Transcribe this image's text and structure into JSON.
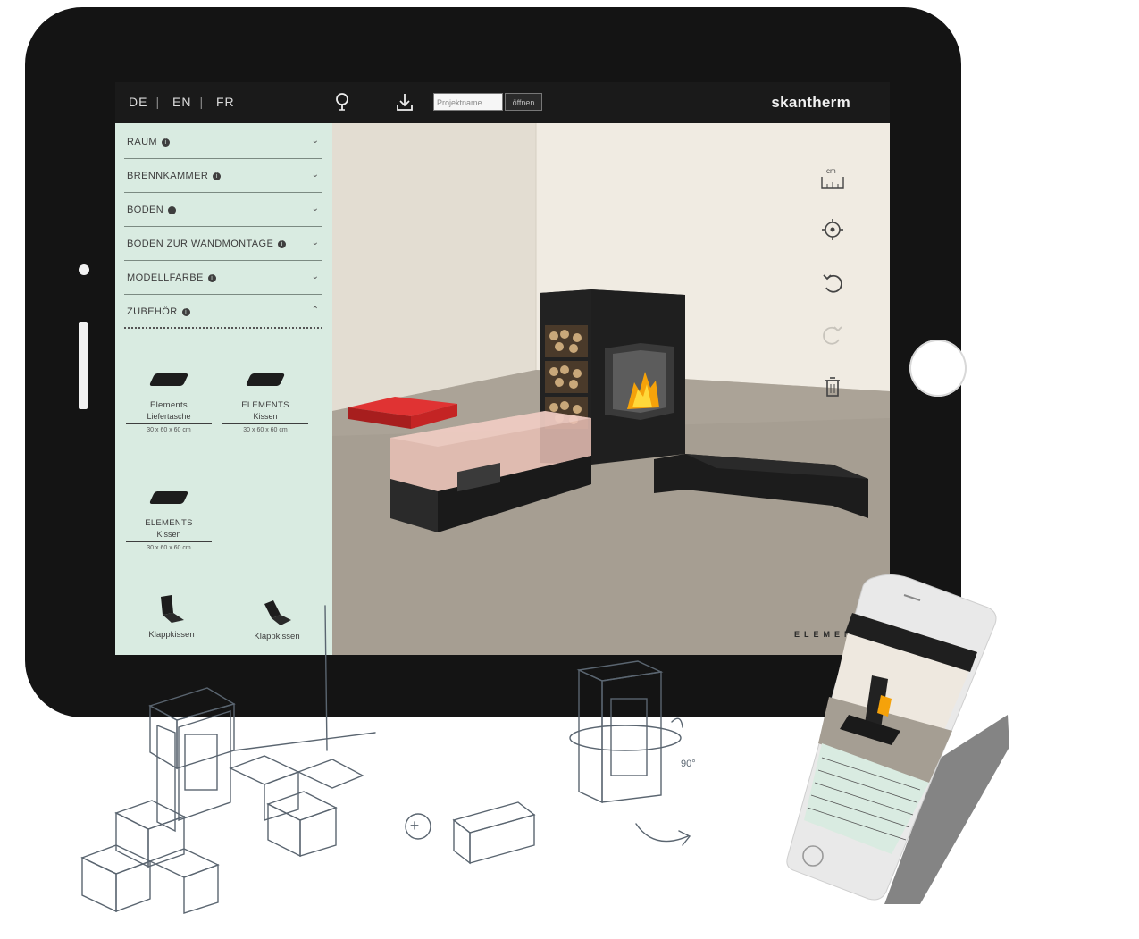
{
  "tablet": {
    "topbar": {
      "languages": [
        "DE",
        "EN",
        "FR"
      ],
      "separator": "|",
      "project_placeholder": "Projektname",
      "project_button": "öffnen",
      "logo": "skantherm"
    },
    "sidebar": {
      "sections": [
        {
          "label": "RAUM",
          "state": "collapsed"
        },
        {
          "label": "BRENNKAMMER",
          "state": "collapsed"
        },
        {
          "label": "BODEN",
          "state": "collapsed"
        },
        {
          "label": "BODEN ZUR WANDMONTAGE",
          "state": "collapsed"
        },
        {
          "label": "MODELLFARBE",
          "state": "collapsed"
        },
        {
          "label": "ZUBEHÖR",
          "state": "expanded"
        }
      ],
      "products": [
        {
          "name": "Elements",
          "name2": "Liefertasche",
          "dims": "30 x 60 x 60 cm"
        },
        {
          "name": "ELEMENTS",
          "name2": "Kissen",
          "dims": "30 x 60 x 60 cm"
        },
        {
          "name": "ELEMENTS",
          "name2": "Kissen",
          "dims": "30 x 60 x 60 cm"
        }
      ],
      "partial_products": [
        "Klappkissen",
        "Klappkissen"
      ]
    },
    "viewport": {
      "tools": [
        "ruler-icon",
        "recenter-icon",
        "undo-icon",
        "redo-icon",
        "trash-icon"
      ],
      "brand": "ELEMENTS"
    }
  },
  "sketch": {
    "plus_symbol": "+",
    "rotation_note": "90°"
  },
  "colors": {
    "tablet_frame": "#141414",
    "sidebar_bg": "#d9ebe1",
    "wall": "#ece6dc",
    "floor": "#a69e92",
    "cushion_red": "#d42a2a",
    "sketch_ink": "#5a6570"
  }
}
